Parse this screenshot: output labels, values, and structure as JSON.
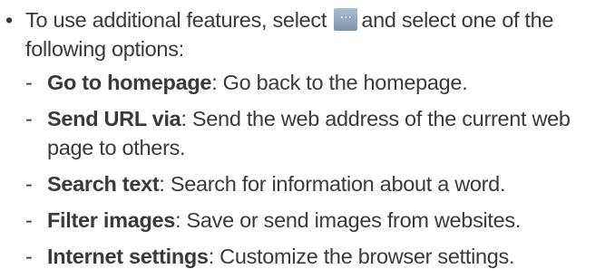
{
  "main_bullet": {
    "marker": "•",
    "text_before": "To use additional features, select",
    "button_icon": "more-dots-icon",
    "button_glyph": "···",
    "text_after": "and select one of the following options:"
  },
  "options": [
    {
      "marker": "-",
      "term": "Go to homepage",
      "desc": ": Go back to the homepage."
    },
    {
      "marker": "-",
      "term": "Send URL via",
      "desc": ": Send the web address of the current web page to others."
    },
    {
      "marker": "-",
      "term": "Search text",
      "desc": ": Search for information about a word."
    },
    {
      "marker": "-",
      "term": "Filter images",
      "desc": ": Save or send images from websites."
    },
    {
      "marker": "-",
      "term": "Internet settings",
      "desc": ": Customize the browser settings."
    }
  ],
  "colors": {
    "text": "#3a3a3a",
    "button_top": "#a9bed0",
    "button_bottom": "#7e97ad"
  }
}
